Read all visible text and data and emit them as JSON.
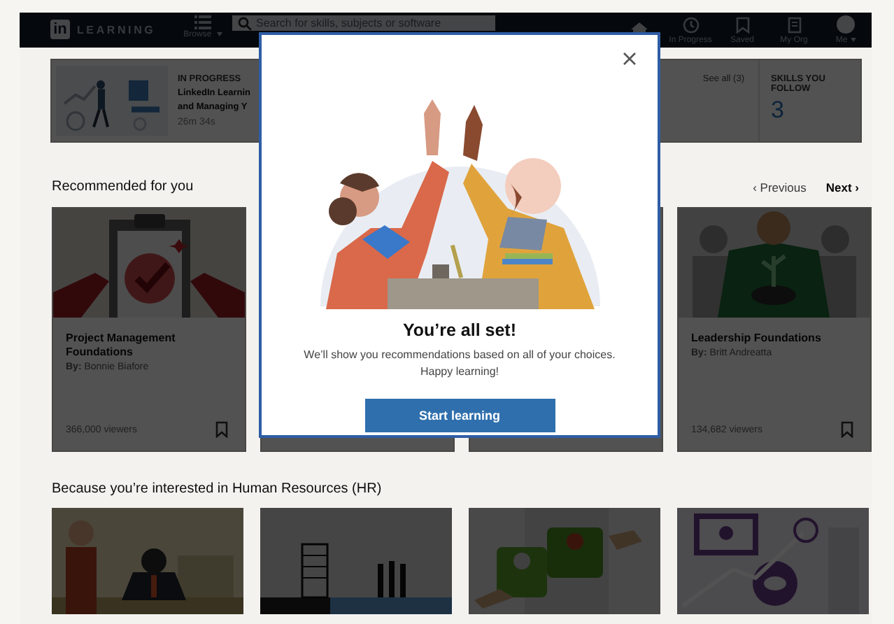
{
  "header": {
    "logo": "in",
    "brand": "LEARNING",
    "browse": "Browse",
    "search": {
      "placeholder": "Search for skills, subjects or software"
    },
    "nav": [
      {
        "kind": "home"
      },
      {
        "kind": "clock",
        "label": "In Progress"
      },
      {
        "kind": "bookmark",
        "label": "Saved"
      },
      {
        "kind": "building",
        "label": "My Org"
      },
      {
        "kind": "avatar",
        "label": "Me"
      }
    ]
  },
  "in_progress": {
    "label": "IN PROGRESS",
    "title_lines": [
      "LinkedIn Learnin",
      "and Managing Y"
    ],
    "duration": "26m 34s",
    "see_all": "See all (3)"
  },
  "skills": {
    "label": "SKILLS YOU FOLLOW",
    "count": "3"
  },
  "recommended": {
    "title": "Recommended for you",
    "previous": {
      "label": "‹ Previous",
      "disabled": true
    },
    "next": {
      "label": "Next ›",
      "disabled": false
    },
    "cards": [
      {
        "kind": "course",
        "title": "Project Management Foundations",
        "author": "**By:** Bonnie Biafore",
        "viewers": "366,000 viewers"
      },
      {
        "kind": "covered"
      },
      {
        "kind": "covered"
      },
      {
        "kind": "course",
        "title": "Leadership Foundations",
        "author": "**By:** Britt Andreatta",
        "viewers": "134,682 viewers"
      }
    ]
  },
  "hr": {
    "title": "Because you’re interested in Human Resources (HR)"
  },
  "modal": {
    "title": "You’re all set!",
    "message_lines": [
      "We’ll show you recommendations based on all of your choices.",
      "Happy learning!"
    ],
    "button": "Start learning"
  }
}
